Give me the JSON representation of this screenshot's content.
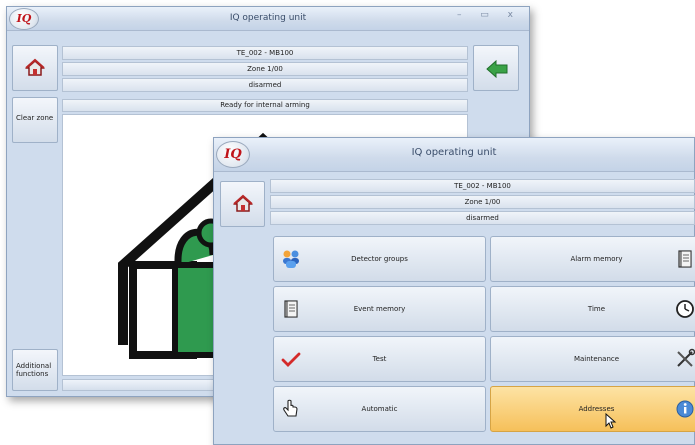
{
  "back_window": {
    "logo": "IQ",
    "title": "IQ operating unit",
    "controls": "– ▭ x",
    "device": "TE_002 - MB100",
    "zone": "Zone  1/00",
    "state": "disarmed",
    "status_message": "Ready for internal arming",
    "clear_zone_label": "Clear zone",
    "additional_functions_label": "Additional functions",
    "accent_green": "#2f9a4f"
  },
  "front_window": {
    "logo": "IQ",
    "title": "IQ operating unit",
    "device": "TE_002 - MB100",
    "zone": "Zone  1/00",
    "state": "disarmed",
    "menu": [
      {
        "label": "Detector groups",
        "icon": "detector-groups-icon"
      },
      {
        "label": "Alarm memory",
        "icon": "document-stack-icon"
      },
      {
        "label": "Event memory",
        "icon": "document-stack-icon"
      },
      {
        "label": "Time",
        "icon": "clock-icon"
      },
      {
        "label": "Test",
        "icon": "checkmark-icon"
      },
      {
        "label": "Maintenance",
        "icon": "tools-icon"
      },
      {
        "label": "Automatic",
        "icon": "hand-pointer-icon"
      },
      {
        "label": "Addresses",
        "icon": "info-icon"
      }
    ],
    "active_item": "Addresses",
    "active_color": "#f6c05a"
  }
}
